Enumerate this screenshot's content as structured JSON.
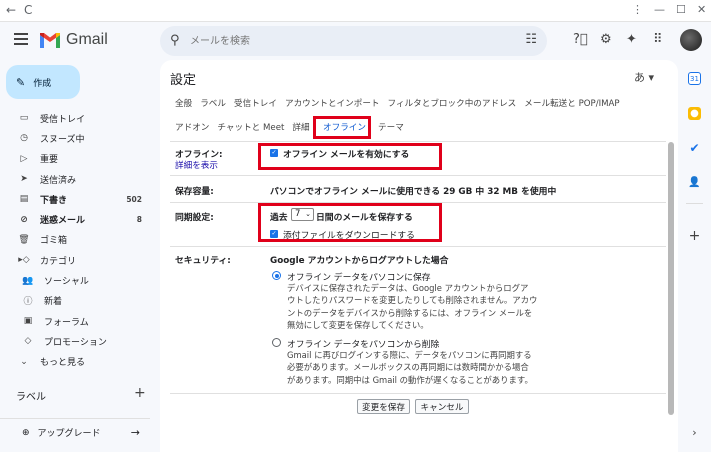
{
  "browser": {
    "back": "←",
    "refresh": "C",
    "menu": "⋮",
    "minimize": "—",
    "maximize": "☐",
    "close": "✕"
  },
  "app": {
    "name": "Gmail"
  },
  "search": {
    "placeholder": "メールを検索"
  },
  "compose": {
    "label": "作成"
  },
  "nav": [
    {
      "label": "受信トレイ",
      "icon": "inbox-icon",
      "glyph": "▭",
      "count": ""
    },
    {
      "label": "スヌーズ中",
      "icon": "clock-icon",
      "glyph": "◷",
      "count": ""
    },
    {
      "label": "重要",
      "icon": "important-icon",
      "glyph": "▷",
      "count": ""
    },
    {
      "label": "送信済み",
      "icon": "send-icon",
      "glyph": "➤",
      "count": ""
    },
    {
      "label": "下書き",
      "icon": "draft-icon",
      "glyph": "▤",
      "count": "502",
      "bold": true
    },
    {
      "label": "迷惑メール",
      "icon": "spam-icon",
      "glyph": "⊘",
      "count": "8",
      "bold": true
    },
    {
      "label": "ゴミ箱",
      "icon": "trash-icon",
      "glyph": "🗑",
      "count": ""
    },
    {
      "label": "カテゴリ",
      "icon": "label-icon",
      "glyph": "▸◇",
      "count": ""
    },
    {
      "label": "ソーシャル",
      "icon": "people-icon",
      "glyph": "👥",
      "count": "",
      "sub": true
    },
    {
      "label": "新着",
      "icon": "info-icon",
      "glyph": "ⓘ",
      "count": "",
      "sub": true
    },
    {
      "label": "フォーラム",
      "icon": "forum-icon",
      "glyph": "▣",
      "count": "",
      "sub": true
    },
    {
      "label": "プロモーション",
      "icon": "tag-icon",
      "glyph": "◇",
      "count": "",
      "sub": true
    },
    {
      "label": "もっと見る",
      "icon": "chevron-down-icon",
      "glyph": "⌄",
      "count": ""
    }
  ],
  "labels_heading": "ラベル",
  "upgrade": {
    "label": "アップグレード"
  },
  "settings": {
    "title": "設定",
    "lang": "あ ▾",
    "tabs_row1": [
      "全般",
      "ラベル",
      "受信トレイ",
      "アカウントとインポート",
      "フィルタとブロック中のアドレス",
      "メール転送と POP/IMAP"
    ],
    "tabs_row2": [
      "アドオン",
      "チャットと Meet",
      "詳細"
    ],
    "tab_active": "オフライン",
    "tab_after": "テーマ",
    "offline_label": "オフライン:",
    "details_link": "詳細を表示",
    "enable_offline": "オフライン メールを有効にする",
    "storage_label": "保存容量:",
    "storage_value": "パソコンでオフライン メールに使用できる 29 GB 中 32 MB を使用中",
    "sync_label": "同期設定:",
    "sync_prefix": "過去",
    "sync_days": "7",
    "sync_suffix": "日間のメールを保存する",
    "download_attachments": "添付ファイルをダウンロードする",
    "security_label": "セキュリティ:",
    "security_heading": "Google アカウントからログアウトした場合",
    "keep_option": "オフライン データをパソコンに保存",
    "keep_desc": [
      "デバイスに保存されたデータは、Google アカウントからログア",
      "ウトしたりパスワードを変更したりしても削除されません。アカウ",
      "ントのデータをデバイスから削除するには、オフライン メールを",
      "無効にして変更を保存してください。"
    ],
    "remove_option": "オフライン データをパソコンから削除",
    "remove_desc": [
      "Gmail に再びログインする際に、データをパソコンに再同期する",
      "必要があります。メールボックスの再同期には数時間かかる場合",
      "があります。同期中は Gmail の動作が遅くなることがあります。"
    ],
    "save_button": "変更を保存",
    "cancel_button": "キャンセル"
  },
  "colors": {
    "accent": "#0b57d0",
    "highlight_box": "#e0001a",
    "compose_bg": "#c2e7ff"
  }
}
